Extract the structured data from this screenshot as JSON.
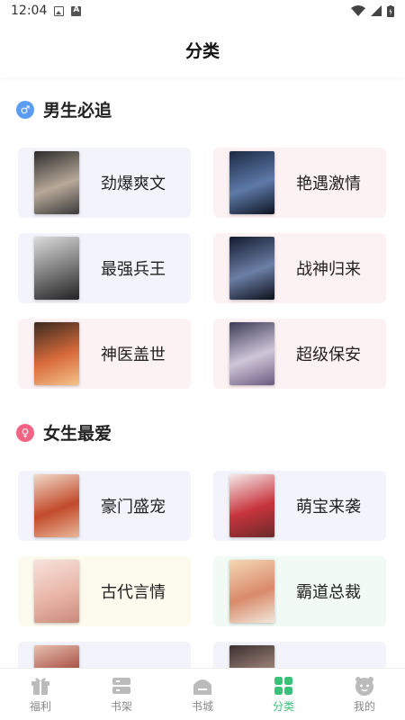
{
  "status_bar": {
    "time": "12:04"
  },
  "header": {
    "title": "分类"
  },
  "sections": [
    {
      "title": "男生必追",
      "icon": "male-icon",
      "icon_glyph": "♂",
      "items": [
        {
          "label": "劲爆爽文",
          "bg": "#f3f4fb",
          "cover_colors": [
            "#2b2b2b",
            "#b8a999",
            "#3a3a3a"
          ]
        },
        {
          "label": "艳遇激情",
          "bg": "#fdf2f3",
          "cover_colors": [
            "#1b2a44",
            "#5d7aa8",
            "#0d1422"
          ]
        },
        {
          "label": "最强兵王",
          "bg": "#f3f4fb",
          "cover_colors": [
            "#dcdcdc",
            "#777777",
            "#222222"
          ]
        },
        {
          "label": "战神归来",
          "bg": "#fdf2f3",
          "cover_colors": [
            "#121a2e",
            "#6c7fa6",
            "#0b0f1a"
          ]
        },
        {
          "label": "神医盖世",
          "bg": "#fdf2f3",
          "cover_colors": [
            "#3a2a20",
            "#d86a3a",
            "#f3c389"
          ]
        },
        {
          "label": "超级保安",
          "bg": "#fdf2f3",
          "cover_colors": [
            "#3c3c57",
            "#cfc7d9",
            "#6b5a80"
          ]
        }
      ]
    },
    {
      "title": "女生最爱",
      "icon": "female-icon",
      "icon_glyph": "♀",
      "items": [
        {
          "label": "豪门盛宠",
          "bg": "#f3f4fb",
          "cover_colors": [
            "#f0d9c8",
            "#c24a2a",
            "#e8b89a"
          ]
        },
        {
          "label": "萌宝来袭",
          "bg": "#f3f4fb",
          "cover_colors": [
            "#f5eaea",
            "#c8343c",
            "#6a2a2a"
          ]
        },
        {
          "label": "古代言情",
          "bg": "#fdfaee",
          "cover_colors": [
            "#f7e2dc",
            "#e9b6a8",
            "#c98a7a"
          ]
        },
        {
          "label": "霸道总裁",
          "bg": "#f2faf5",
          "cover_colors": [
            "#f5d8b5",
            "#d98a6a",
            "#f2e9dd"
          ]
        },
        {
          "label": "",
          "bg": "#f3f4fb",
          "cover_colors": [
            "#e7c0ae",
            "#a2463a",
            "#f4ddd0"
          ]
        },
        {
          "label": "",
          "bg": "#f3f4fb",
          "cover_colors": [
            "#3a3030",
            "#a78b7e",
            "#e1d1c8"
          ]
        }
      ]
    }
  ],
  "tabs": [
    {
      "label": "福利",
      "icon": "gift-icon",
      "active": false
    },
    {
      "label": "书架",
      "icon": "bookshelf-icon",
      "active": false
    },
    {
      "label": "书城",
      "icon": "bookstore-icon",
      "active": false
    },
    {
      "label": "分类",
      "icon": "category-grid-icon",
      "active": true
    },
    {
      "label": "我的",
      "icon": "profile-face-icon",
      "active": false
    }
  ],
  "colors": {
    "accent": "#3ac27a",
    "inactive": "#bbbbbb"
  }
}
